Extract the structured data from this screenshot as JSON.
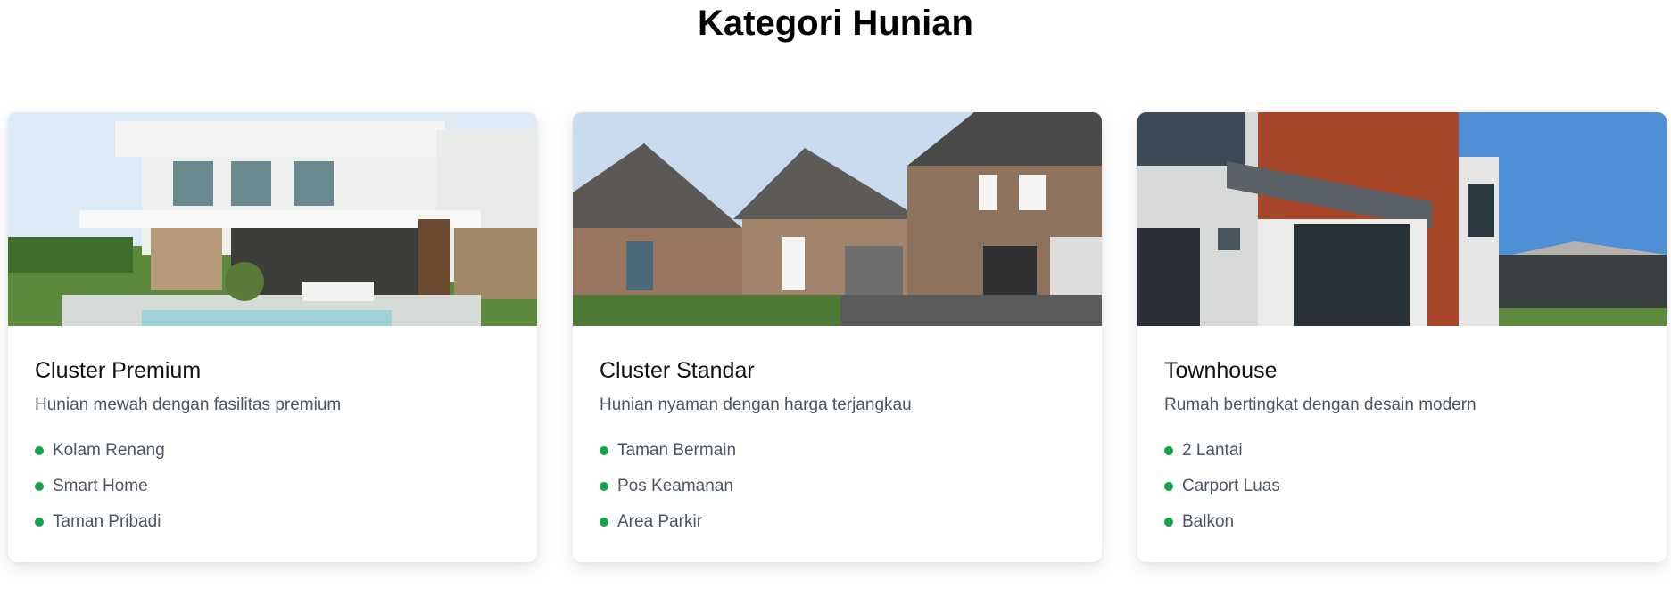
{
  "header": {
    "title": "Kategori Hunian"
  },
  "accent": {
    "bullet_color": "#16a34a"
  },
  "categories": [
    {
      "title": "Cluster Premium",
      "description": "Hunian mewah dengan fasilitas premium",
      "image": "modern-villa-photo",
      "features": [
        "Kolam Renang",
        "Smart Home",
        "Taman Pribadi"
      ]
    },
    {
      "title": "Cluster Standar",
      "description": "Hunian nyaman dengan harga terjangkau",
      "image": "suburban-houses-photo",
      "features": [
        "Taman Bermain",
        "Pos Keamanan",
        "Area Parkir"
      ]
    },
    {
      "title": "Townhouse",
      "description": "Rumah bertingkat dengan desain modern",
      "image": "modern-townhouse-photo",
      "features": [
        "2 Lantai",
        "Carport Luas",
        "Balkon"
      ]
    }
  ]
}
